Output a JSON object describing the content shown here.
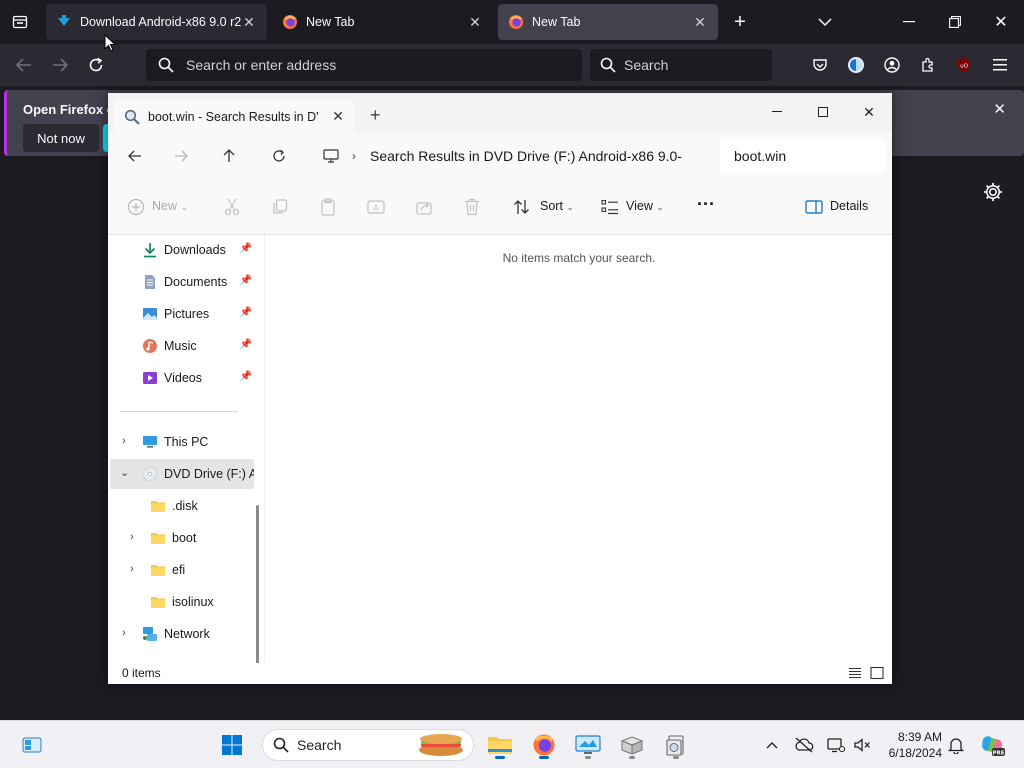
{
  "browser": {
    "tabs": [
      {
        "title": "Download Android-x86 9.0 r2 (",
        "state": "background"
      },
      {
        "title": "New Tab",
        "state": "background"
      },
      {
        "title": "New Tab",
        "state": "active"
      }
    ],
    "url_placeholder": "Search or enter address",
    "search_placeholder": "Search",
    "notification": {
      "title": "Open Firefox ev",
      "not_now_label": "Not now"
    },
    "accent_color": "#b833e1"
  },
  "explorer": {
    "tab_title": "boot.win - Search Results in D'",
    "breadcrumb": "Search Results in DVD Drive (F:) Android-x86 9.0-",
    "search_value": "boot.win",
    "toolbar": {
      "new_label": "New",
      "sort_label": "Sort",
      "view_label": "View",
      "more_label": "...",
      "details_label": "Details"
    },
    "nav": {
      "quick_access": [
        {
          "label": "Downloads",
          "icon": "download-icon"
        },
        {
          "label": "Documents",
          "icon": "document-icon"
        },
        {
          "label": "Pictures",
          "icon": "pictures-icon"
        },
        {
          "label": "Music",
          "icon": "music-icon"
        },
        {
          "label": "Videos",
          "icon": "videos-icon"
        }
      ],
      "this_pc": "This PC",
      "dvd_drive": "DVD Drive (F:) A",
      "dvd_children": [
        ".disk",
        "boot",
        "efi",
        "isolinux"
      ],
      "network": "Network"
    },
    "empty_message": "No items match your search.",
    "status_count": "0 items"
  },
  "taskbar": {
    "search_placeholder": "Search",
    "time": "8:39 AM",
    "date": "6/18/2024",
    "accent_color": "#0067c0"
  }
}
